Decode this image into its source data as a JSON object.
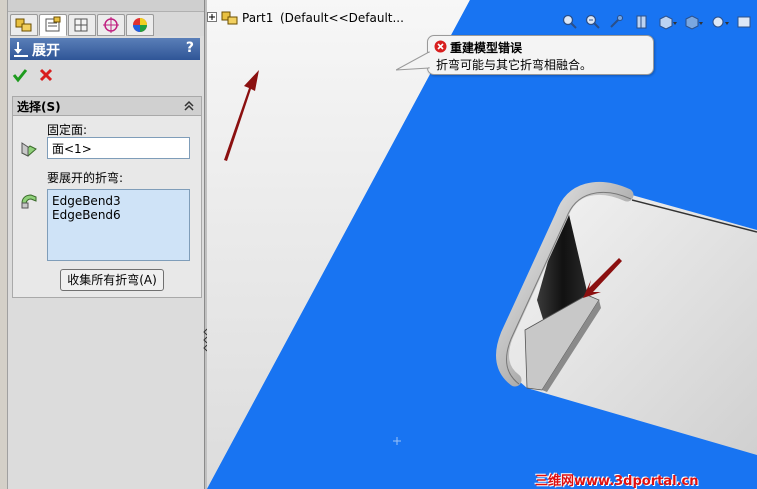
{
  "panel": {
    "title": "展开",
    "help": "?",
    "selections": {
      "header": "选择(S)",
      "fixed_face_label": "固定面:",
      "fixed_face_value": "面<1>",
      "bends_label": "要展开的折弯:",
      "bends": [
        "EdgeBend3",
        "EdgeBend6"
      ],
      "collect_button": "收集所有折弯(A)"
    }
  },
  "tree": {
    "part_label": "Part1",
    "config_label": "(Default<<Default..."
  },
  "error_callout": {
    "title": "重建模型错误",
    "message": "折弯可能与其它折弯相融合。"
  },
  "watermark": "三维网www.3dportal.cn",
  "colors": {
    "model_blue": "#1874f2",
    "panel_title": "#2f5597",
    "arrow": "#8b1010",
    "error_red": "#d81e1e"
  }
}
